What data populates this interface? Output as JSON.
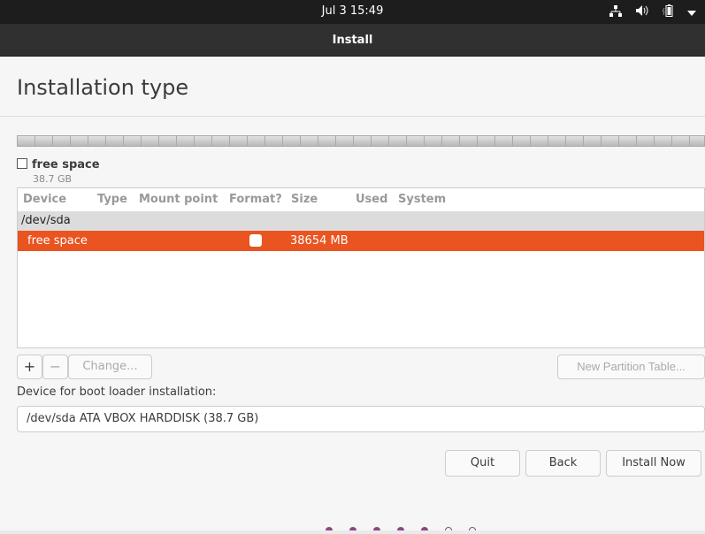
{
  "topbar": {
    "clock": "Jul 3  15:49",
    "icons": [
      "network-icon",
      "volume-icon",
      "battery-icon",
      "chevron-down-icon"
    ]
  },
  "window": {
    "title": "Install"
  },
  "page": {
    "title": "Installation type"
  },
  "legend": {
    "name": "free space",
    "size": "38.7 GB"
  },
  "table": {
    "columns": [
      "Device",
      "Type",
      "Mount point",
      "Format?",
      "Size",
      "Used",
      "System"
    ],
    "device": "/dev/sda",
    "rows": [
      {
        "device": "free space",
        "type": "",
        "mount": "",
        "format": false,
        "size": "38654 MB",
        "used": "",
        "system": ""
      }
    ]
  },
  "buttons": {
    "add": "+",
    "remove": "−",
    "change": "Change...",
    "new_table": "New Partition Table...",
    "quit": "Quit",
    "back": "Back",
    "install": "Install Now"
  },
  "bootloader": {
    "label": "Device for boot loader installation:",
    "value": "/dev/sda ATA VBOX HARDDISK (38.7 GB)"
  },
  "progress": {
    "total_steps": 7,
    "completed_steps": 5
  },
  "colors": {
    "accent": "#e95420",
    "progress": "#8e4585"
  }
}
